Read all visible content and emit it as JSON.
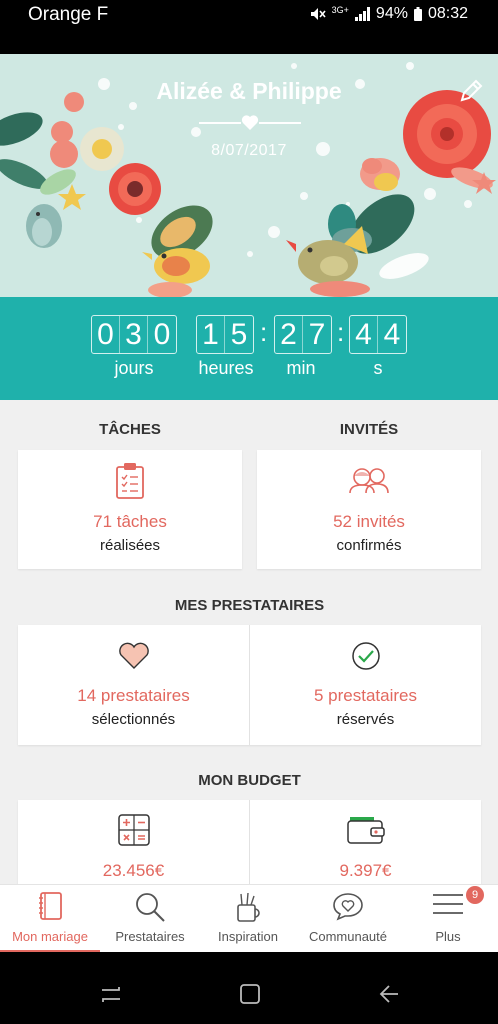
{
  "status_bar": {
    "carrier": "Orange F",
    "network": "3G+",
    "battery": "94%",
    "time": "08:32",
    "icons": [
      "mute-icon",
      "signal-icon",
      "battery-icon"
    ]
  },
  "hero": {
    "title": "Alizée & Philippe",
    "date": "8/07/2017",
    "edit_icon": "pencil-icon"
  },
  "countdown": {
    "days": [
      "0",
      "3",
      "0"
    ],
    "hours": [
      "1",
      "5"
    ],
    "minutes": [
      "2",
      "7"
    ],
    "seconds": [
      "4",
      "4"
    ],
    "separator": ":",
    "labels": {
      "days": "jours",
      "hours": "heures",
      "minutes": "min",
      "seconds": "s"
    }
  },
  "tasks": {
    "title": "TÂCHES",
    "count": "71 tâches",
    "sub": "réalisées",
    "icon": "clipboard-icon"
  },
  "guests": {
    "title": "INVITÉS",
    "count": "52 invités",
    "sub": "confirmés",
    "icon": "couple-icon"
  },
  "vendors": {
    "title": "MES PRESTATAIRES",
    "selected_count": "14 prestataires",
    "selected_sub": "sélectionnés",
    "reserved_count": "5 prestataires",
    "reserved_sub": "réservés"
  },
  "budget": {
    "title": "MON BUDGET",
    "estimated": "23.456€",
    "spent": "9.397€"
  },
  "bottom_nav": {
    "items": [
      {
        "label": "Mon mariage",
        "icon": "book-icon",
        "active": true
      },
      {
        "label": "Prestataires",
        "icon": "search-icon",
        "active": false
      },
      {
        "label": "Inspiration",
        "icon": "inspiration-icon",
        "active": false
      },
      {
        "label": "Communauté",
        "icon": "chat-heart-icon",
        "active": false
      },
      {
        "label": "Plus",
        "icon": "menu-icon",
        "active": false
      }
    ],
    "badge": "9"
  },
  "colors": {
    "accent": "#e2685f",
    "teal": "#1fb1ab",
    "hero_bg": "#cfe8e2"
  }
}
